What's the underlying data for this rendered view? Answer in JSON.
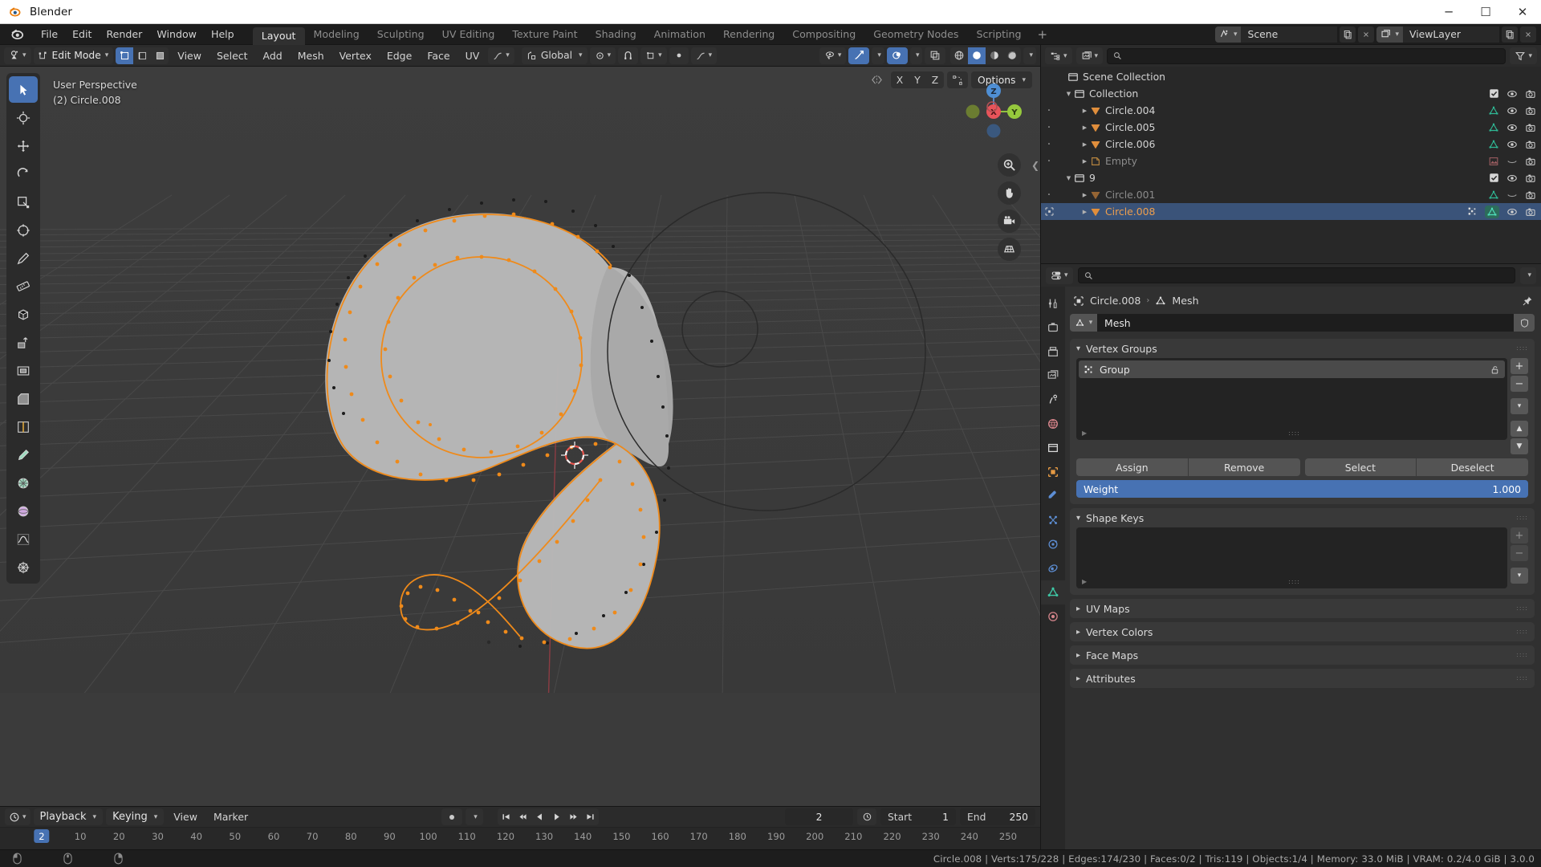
{
  "window": {
    "title": "Blender",
    "buttons": {
      "minimize": "─",
      "maximize": "☐",
      "close": "✕"
    }
  },
  "menubar": {
    "items": [
      "File",
      "Edit",
      "Render",
      "Window",
      "Help"
    ],
    "workspaces": [
      {
        "label": "Layout",
        "active": true
      },
      {
        "label": "Modeling",
        "active": false
      },
      {
        "label": "Sculpting",
        "active": false
      },
      {
        "label": "UV Editing",
        "active": false
      },
      {
        "label": "Texture Paint",
        "active": false
      },
      {
        "label": "Shading",
        "active": false
      },
      {
        "label": "Animation",
        "active": false
      },
      {
        "label": "Rendering",
        "active": false
      },
      {
        "label": "Compositing",
        "active": false
      },
      {
        "label": "Geometry Nodes",
        "active": false
      },
      {
        "label": "Scripting",
        "active": false
      }
    ],
    "add_workspace": "+",
    "scene_name": "Scene",
    "view_layer_name": "ViewLayer"
  },
  "viewport_header": {
    "mode": "Edit Mode",
    "menus": [
      "View",
      "Select",
      "Add",
      "Mesh",
      "Vertex",
      "Edge",
      "Face",
      "UV"
    ],
    "transform_orientation": "Global",
    "select_modes": [
      "vertex-select",
      "edge-select",
      "face-select"
    ],
    "active_select_mode": 0
  },
  "viewport_subheader": {
    "axis_buttons": [
      "X",
      "Y",
      "Z"
    ],
    "options_label": "Options"
  },
  "viewport": {
    "perspective_label": "User Perspective",
    "object_label": "(2) Circle.008",
    "gizmo_axes": [
      "X",
      "Y",
      "Z"
    ],
    "accent_orange": "#ed9e4e",
    "accent_blue": "#4772b3"
  },
  "toolbar": {
    "tools": [
      {
        "name": "tweak-tool",
        "active": true
      },
      {
        "name": "cursor-tool",
        "active": false
      },
      {
        "name": "move-tool",
        "active": false
      },
      {
        "name": "rotate-tool",
        "active": false
      },
      {
        "name": "scale-tool",
        "active": false
      },
      {
        "name": "transform-tool",
        "active": false
      },
      {
        "name": "annotate-tool",
        "active": false
      },
      {
        "name": "measure-tool",
        "active": false
      },
      {
        "name": "add-cube-tool",
        "active": false
      },
      {
        "name": "extrude-region-tool",
        "active": false
      },
      {
        "name": "inset-faces-tool",
        "active": false
      },
      {
        "name": "bevel-tool",
        "active": false
      },
      {
        "name": "loop-cut-tool",
        "active": false
      },
      {
        "name": "knife-tool",
        "active": false
      },
      {
        "name": "poly-build-tool",
        "active": false
      },
      {
        "name": "spin-tool",
        "active": false
      },
      {
        "name": "smooth-tool",
        "active": false
      },
      {
        "name": "shear-tool",
        "active": false
      }
    ]
  },
  "outliner": {
    "search_placeholder": "",
    "rows": [
      {
        "label": "Scene Collection",
        "depth": 0,
        "icon": "collection-icon",
        "expandable": false,
        "checkbox": false,
        "eye": false,
        "camera": false,
        "selected": false,
        "dimmed": false,
        "has_mesh_data": false,
        "disclosure": ""
      },
      {
        "label": "Collection",
        "depth": 1,
        "icon": "collection-icon",
        "expandable": true,
        "checkbox": true,
        "eye": true,
        "camera": true,
        "selected": false,
        "dimmed": false,
        "has_mesh_data": false,
        "disclosure": "▼"
      },
      {
        "label": "Circle.004",
        "depth": 2,
        "icon": "mesh-object-icon",
        "expandable": true,
        "checkbox": false,
        "eye": true,
        "camera": true,
        "selected": false,
        "dimmed": false,
        "has_mesh_data": true,
        "disclosure": "▶"
      },
      {
        "label": "Circle.005",
        "depth": 2,
        "icon": "mesh-object-icon",
        "expandable": true,
        "checkbox": false,
        "eye": true,
        "camera": true,
        "selected": false,
        "dimmed": false,
        "has_mesh_data": true,
        "disclosure": "▶"
      },
      {
        "label": "Circle.006",
        "depth": 2,
        "icon": "mesh-object-icon",
        "expandable": true,
        "checkbox": false,
        "eye": true,
        "camera": true,
        "selected": false,
        "dimmed": false,
        "has_mesh_data": true,
        "disclosure": "▶"
      },
      {
        "label": "Empty",
        "depth": 2,
        "icon": "empty-image-icon",
        "expandable": true,
        "checkbox": false,
        "eye": "closed",
        "camera": true,
        "selected": false,
        "dimmed": true,
        "has_mesh_data": false,
        "disclosure": "▶"
      },
      {
        "label": "9",
        "depth": 1,
        "icon": "collection-icon",
        "expandable": true,
        "checkbox": true,
        "eye": true,
        "camera": true,
        "selected": false,
        "dimmed": false,
        "has_mesh_data": false,
        "disclosure": "▼"
      },
      {
        "label": "Circle.001",
        "depth": 2,
        "icon": "mesh-object-icon",
        "expandable": true,
        "checkbox": false,
        "eye": "closed",
        "camera": true,
        "selected": false,
        "dimmed": true,
        "has_mesh_data": true,
        "disclosure": "▶"
      },
      {
        "label": "Circle.008",
        "depth": 2,
        "icon": "mesh-object-icon",
        "expandable": true,
        "checkbox": false,
        "eye": true,
        "camera": true,
        "selected": true,
        "dimmed": false,
        "has_mesh_data": true,
        "disclosure": "▶"
      }
    ]
  },
  "properties": {
    "search_placeholder": "",
    "breadcrumb": {
      "object": "Circle.008",
      "separator": "›",
      "data": "Mesh"
    },
    "id_name": "Mesh",
    "panels": {
      "vertex_groups": {
        "title": "Vertex Groups",
        "items": [
          {
            "label": "Group"
          }
        ],
        "buttons": {
          "assign": "Assign",
          "remove": "Remove",
          "select": "Select",
          "deselect": "Deselect"
        },
        "weight_label": "Weight",
        "weight_value": "1.000"
      },
      "shape_keys": {
        "title": "Shape Keys",
        "items": []
      },
      "uv_maps": {
        "title": "UV Maps"
      },
      "vertex_colors": {
        "title": "Vertex Colors"
      },
      "face_maps": {
        "title": "Face Maps"
      },
      "attributes": {
        "title": "Attributes"
      }
    },
    "tabs": [
      {
        "name": "tool-tab",
        "active": false
      },
      {
        "name": "render-tab",
        "active": false
      },
      {
        "name": "output-tab",
        "active": false
      },
      {
        "name": "view-layer-tab",
        "active": false
      },
      {
        "name": "scene-tab",
        "active": false
      },
      {
        "name": "world-tab",
        "active": false
      },
      {
        "name": "collection-tab",
        "active": false
      },
      {
        "name": "object-tab",
        "active": false
      },
      {
        "name": "modifier-tab",
        "active": false
      },
      {
        "name": "particles-tab",
        "active": false
      },
      {
        "name": "physics-tab",
        "active": false
      },
      {
        "name": "constraints-tab",
        "active": false
      },
      {
        "name": "object-data-tab",
        "active": true
      },
      {
        "name": "material-tab",
        "active": false
      }
    ]
  },
  "timeline": {
    "menus": [
      "Playback",
      "Keying",
      "View",
      "Marker"
    ],
    "current_frame": "2",
    "start_label": "Start",
    "start_value": "1",
    "end_label": "End",
    "end_value": "250",
    "ticks": [
      "2",
      "10",
      "20",
      "30",
      "40",
      "50",
      "60",
      "70",
      "80",
      "90",
      "100",
      "110",
      "120",
      "130",
      "140",
      "150",
      "160",
      "170",
      "180",
      "190",
      "200",
      "210",
      "220",
      "230",
      "240",
      "250"
    ],
    "playhead_frame": "2"
  },
  "statusbar": {
    "info": "Circle.008 | Verts:175/228 | Edges:174/230 | Faces:0/2 | Tris:119 | Objects:1/4 | Memory: 33.0 MiB | VRAM: 0.2/4.0 GiB | 3.0.0"
  }
}
